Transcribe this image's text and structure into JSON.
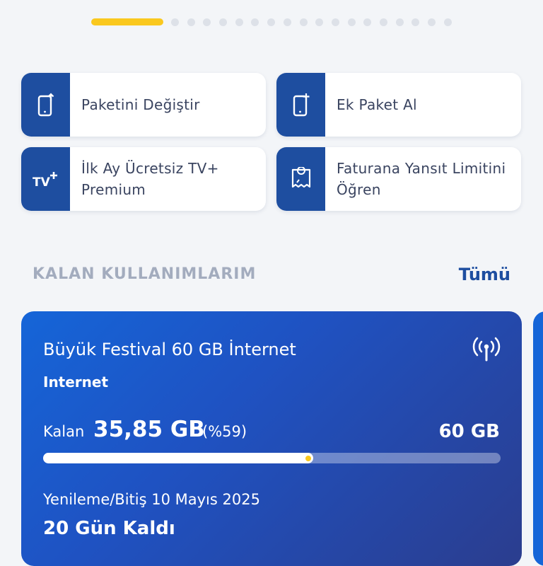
{
  "pager": {
    "total_pages": 19,
    "active_index": 0,
    "active_color": "#fac81e"
  },
  "quick_actions": [
    {
      "icon": "phone-upgrade-icon",
      "label": "Paketini Değiştir"
    },
    {
      "icon": "phone-add-icon",
      "label": "Ek Paket Al"
    },
    {
      "icon": "tv-plus-icon",
      "label": "İlk Ay Ücretsiz TV+ Premium"
    },
    {
      "icon": "bill-limit-icon",
      "label": "Faturana Yansıt Limitini Öğren"
    }
  ],
  "usage_section": {
    "title": "KALAN KULLANIMLARIM",
    "all_link": "Tümü"
  },
  "usage_card": {
    "package_name": "Büyük Festival 60 GB İnternet",
    "type": "Internet",
    "icon": "signal-icon",
    "remaining_label": "Kalan",
    "remaining_value": "35,85 GB",
    "remaining_percent_text": "(%59)",
    "remaining_fraction": 0.59,
    "total": "60 GB",
    "renewal_text": "Yenileme/Bitiş 10 Mayıs 2025",
    "days_left": "20 Gün Kaldı"
  },
  "colors": {
    "brand_blue": "#1e4ea0",
    "accent_yellow": "#fac81e",
    "card_blue": "#1565d8"
  }
}
